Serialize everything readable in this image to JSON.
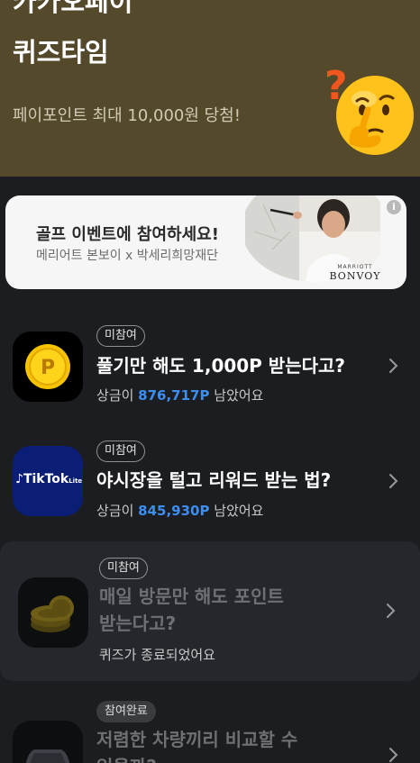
{
  "hero": {
    "title_line1": "카카오페이",
    "title_line2": "퀴즈타임",
    "subtitle": "페이포인트 최대 10,000원 당첨!"
  },
  "banner": {
    "title": "골프 이벤트에 참여하세요!",
    "subtitle": "메리어트 본보이 x 박세리희망재단",
    "brand_small": "MARRIOTT",
    "brand_large": "BONVOY",
    "info_icon": "i"
  },
  "quizzes": [
    {
      "status": "미참여",
      "title": "풀기만 해도 1,000P 받는다고?",
      "prize_prefix": "상금이 ",
      "prize_amount": "876,717P",
      "prize_suffix": " 남았어요",
      "icon": "coin-p-icon"
    },
    {
      "status": "미참여",
      "title": "야시장을 털고 리워드 받는 법?",
      "prize_prefix": "상금이 ",
      "prize_amount": "845,930P",
      "prize_suffix": " 남았어요",
      "logo_text": "TikTok",
      "logo_small": "Lite",
      "icon": "tiktok-lite-icon"
    },
    {
      "status": "미참여",
      "title_line1": "매일 방문만 해도 포인트",
      "title_line2": "받는다고?",
      "ended_text": "퀴즈가 종료되었어요",
      "icon": "coin-stack-icon"
    },
    {
      "status": "참여완료",
      "title_line1": "저렴한 차량끼리 비교할 수",
      "title_line2": "있을까?",
      "icon": "car-icon"
    }
  ],
  "colors": {
    "background": "#1b1d20",
    "hero": "#544a2b",
    "accent_blue": "#3d8ef0",
    "coin_yellow": "#f7c300",
    "tiktok_navy": "#0b1e76"
  }
}
